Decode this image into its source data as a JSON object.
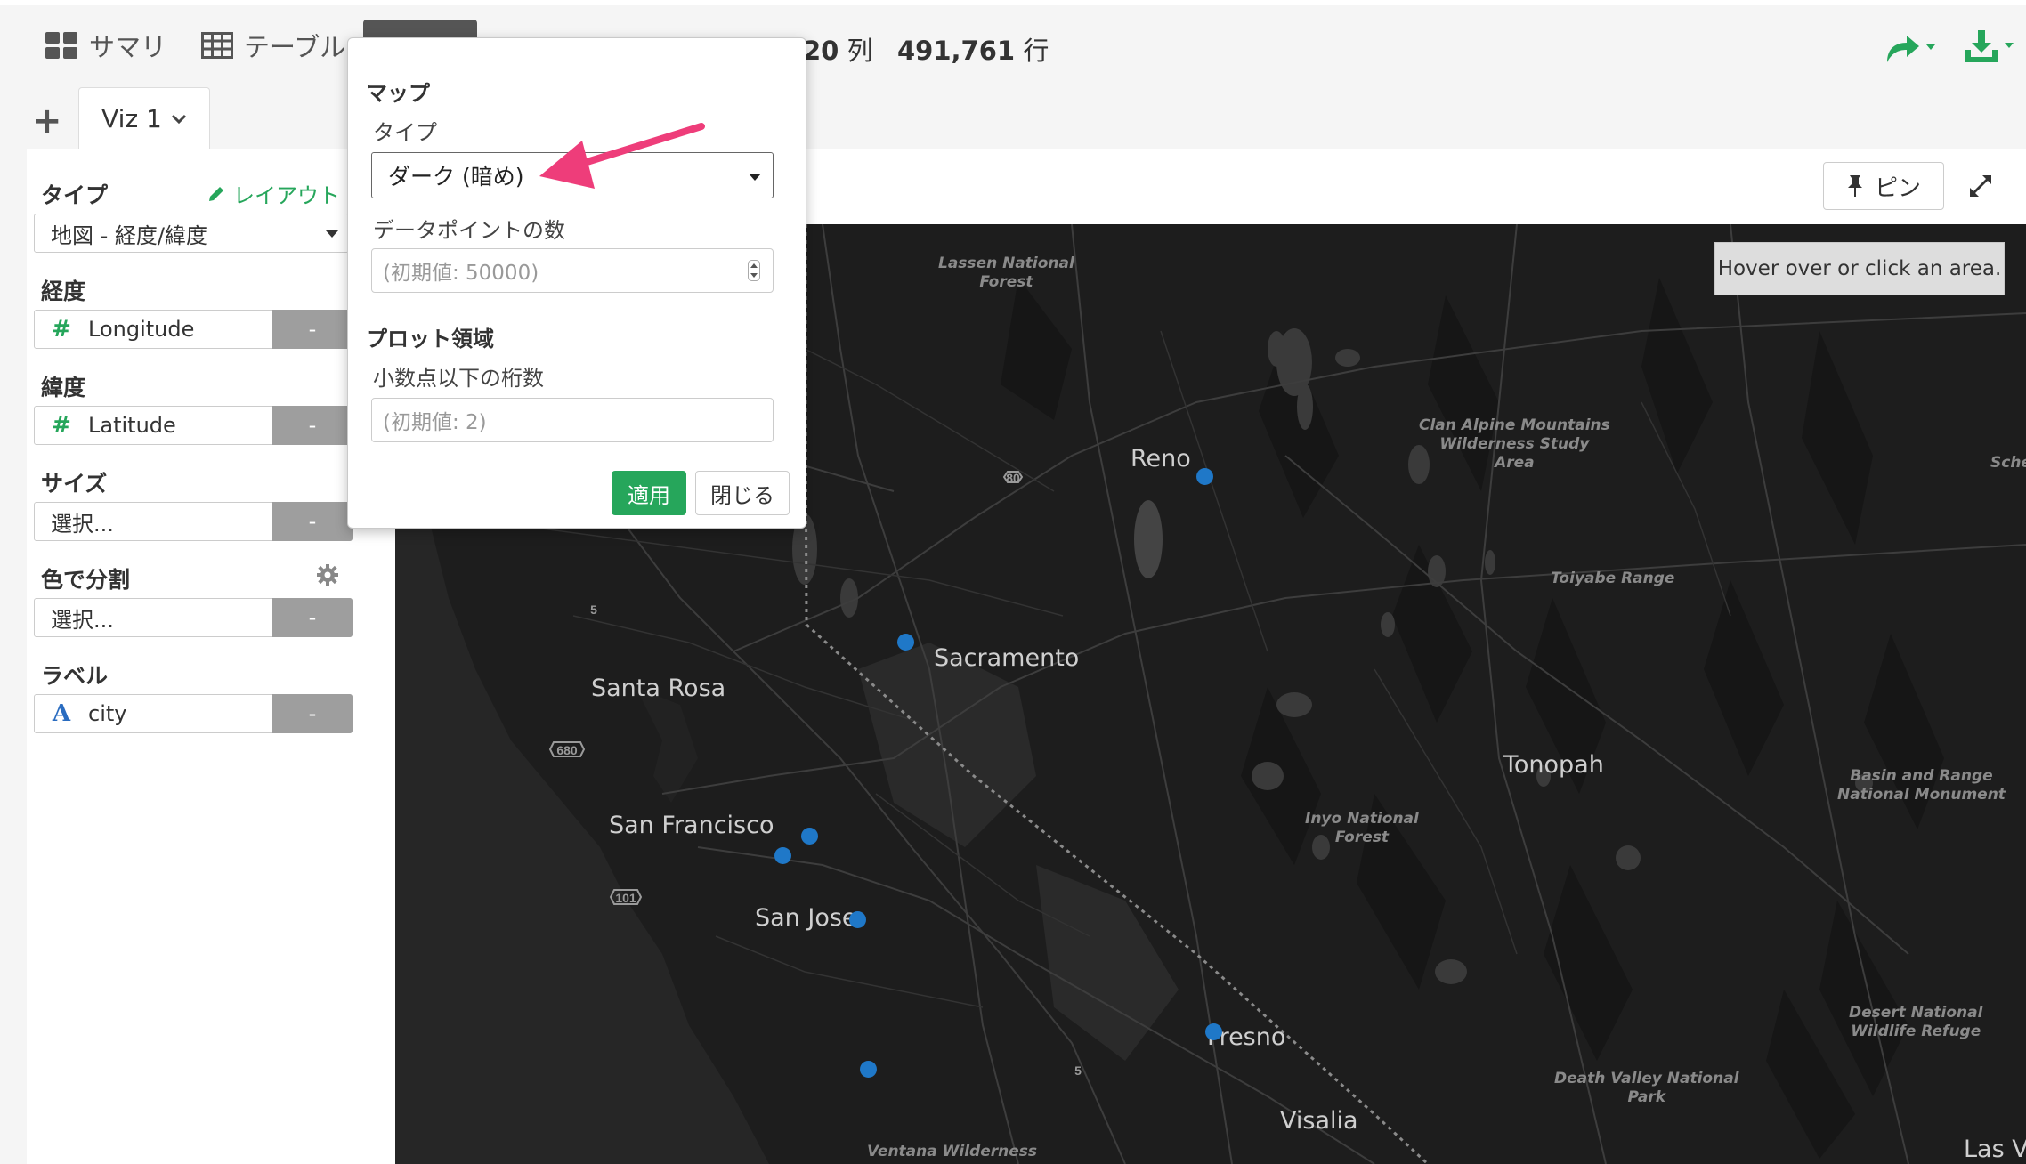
{
  "topbar": {
    "tabs": [
      {
        "label": "サマリ",
        "icon": "grid-icon"
      },
      {
        "label": "テーブル",
        "icon": "table-icon"
      }
    ],
    "columns_count": "20",
    "columns_unit": "列",
    "rows_count": "491,761",
    "rows_unit": "行",
    "share_icon": "share-arrow-icon",
    "download_icon": "download-icon",
    "accent_color": "#26a65b"
  },
  "viz_tabs": {
    "add_label": "+",
    "active_label": "Viz 1"
  },
  "left_panel": {
    "type_label": "タイプ",
    "layout_link": "レイアウト",
    "type_value": "地図 - 経度/緯度",
    "longitude_label": "経度",
    "longitude_value": "Longitude",
    "latitude_label": "緯度",
    "latitude_value": "Latitude",
    "size_label": "サイズ",
    "size_placeholder": "選択...",
    "color_label": "色で分割",
    "color_placeholder": "選択...",
    "label_label": "ラベル",
    "label_value": "city",
    "remove_label": "-"
  },
  "viz_header": {
    "pin_label": "ピン"
  },
  "map": {
    "hover_tip": "Hover over or click an area.",
    "cities": [
      "Reno",
      "Sacramento",
      "Santa Rosa",
      "San Francisco",
      "San Jose",
      "Fresno",
      "Visalia",
      "Tonopah",
      "Las V"
    ],
    "areas": [
      "Lassen National\nForest",
      "Clan Alpine Mountains\nWilderness Study\nArea",
      "Toiyabe Range",
      "Inyo National\nForest",
      "Basin and Range\nNational Monument",
      "Desert National\nWildlife Refuge",
      "Death Valley National\nPark",
      "Ventana Wilderness",
      "Sche"
    ],
    "road_shields": [
      "80",
      "680",
      "101",
      "5",
      "5"
    ],
    "dot_color": "#1f78c8",
    "background_color": "#1d1d1d"
  },
  "popover": {
    "map_heading": "マップ",
    "type_label": "タイプ",
    "type_value": "ダーク (暗め)",
    "datapoints_label": "データポイントの数",
    "datapoints_placeholder": "(初期値: 50000)",
    "plot_heading": "プロット領域",
    "decimals_label": "小数点以下の桁数",
    "decimals_placeholder": "(初期値: 2)",
    "apply_label": "適用",
    "close_label": "閉じる"
  },
  "annotation": {
    "arrow_color": "#ee3d7a"
  }
}
